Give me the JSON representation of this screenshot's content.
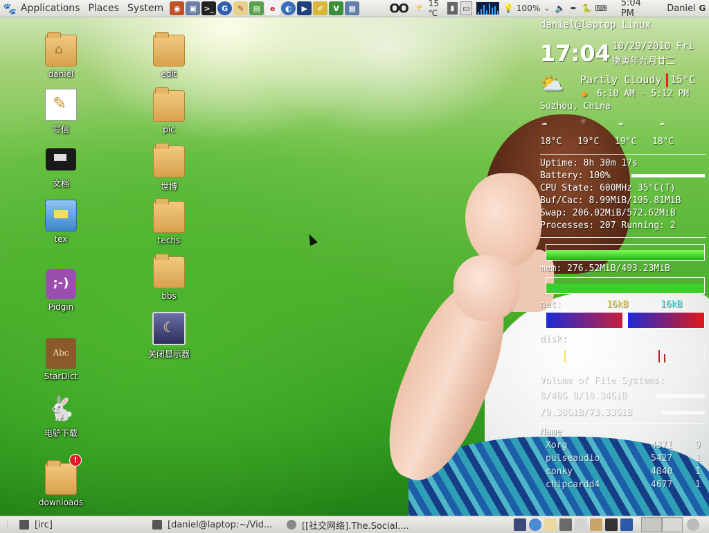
{
  "top_panel": {
    "menus": [
      "Applications",
      "Places",
      "System"
    ],
    "weather": "15 ℃",
    "battery": "100%",
    "clock": "5:04 PM",
    "user": "Daniel"
  },
  "desktop": {
    "col1": [
      {
        "label": "daniel",
        "icon": "home-folder-icon"
      },
      {
        "label": "写信",
        "icon": "mail-editor-icon"
      },
      {
        "label": "文档",
        "icon": "documents-icon"
      },
      {
        "label": "tex",
        "icon": "tex-folder-icon"
      },
      {
        "label": "Pidgin",
        "icon": "pidgin-icon"
      },
      {
        "label": "StarDict",
        "icon": "stardict-icon"
      },
      {
        "label": "电驴下载",
        "icon": "amule-icon"
      },
      {
        "label": "downloads",
        "icon": "downloads-folder-icon"
      }
    ],
    "col2": [
      {
        "label": "edit",
        "icon": "folder-icon"
      },
      {
        "label": "pic",
        "icon": "folder-icon"
      },
      {
        "label": "世博",
        "icon": "folder-icon"
      },
      {
        "label": "techs",
        "icon": "folder-icon"
      },
      {
        "label": "bbs",
        "icon": "folder-icon"
      },
      {
        "label": "关闭显示器",
        "icon": "display-off-icon"
      }
    ]
  },
  "conky": {
    "host": "daniel@laptop Linux",
    "time": "17:04",
    "date": "10/29/2010 Fri",
    "lunar": "庚寅年九月廿二",
    "condition": "Partly Cloudy",
    "temp": "15°C",
    "sun": "6:10 AM - 5:12 PM",
    "location": "Suzhou, China",
    "forecast": [
      "18°C",
      "19°C",
      "19°C",
      "18°C"
    ],
    "uptime": "Uptime: 8h 30m 17s",
    "battery": "Battery:  100%",
    "cpu": "CPU State: 600MHz 35°C(T)",
    "bufcac": "Buf/Cac: 8.99MiB/195.81MiB",
    "swap": "Swap: 206.02MiB/572.62MiB",
    "processes": "Processes: 207  Running: 2",
    "mem": "mem: 276.52MiB/493.23MiB",
    "net_label": "net:",
    "net_down": "16kB",
    "net_up": "16kB",
    "disk_label": "disk:",
    "fs_title": "Volume of File Systems:",
    "fs1": "8/40G 8/18.34GiB",
    "fs2": "/9.38GiB/73.33GiB",
    "proc_header": "Name",
    "procs": [
      {
        "name": "Xorg",
        "pid": "4371",
        "cpu": "9"
      },
      {
        "name": "pulseaudio",
        "pid": "5427",
        "cpu": "1"
      },
      {
        "name": "conky",
        "pid": "4840",
        "cpu": "1"
      },
      {
        "name": "chipcardd4",
        "pid": "4677",
        "cpu": "1"
      }
    ]
  },
  "bottom_panel": {
    "tasks": [
      "[irc]",
      "[daniel@laptop:~/Vid...",
      "[[社交网络].The.Social...."
    ]
  }
}
